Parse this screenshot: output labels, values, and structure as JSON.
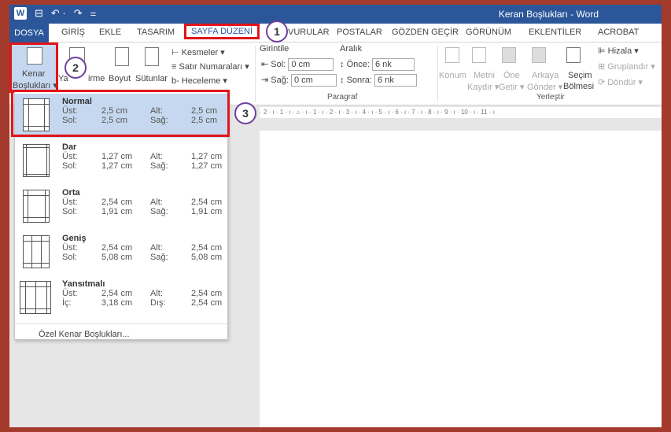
{
  "titlebar": {
    "app_title": "Keran Boşlukları - Word",
    "qa_save": "⊟",
    "qa_undo": "↶ ·",
    "qa_redo": "↷",
    "qa_more": "="
  },
  "tabs": {
    "file": "DOSYA",
    "home": "GİRİŞ",
    "insert": "EKLE",
    "design": "TASARIM",
    "layout": "SAYFA DÜZENİ",
    "references": "BAŞVURULAR",
    "mailings": "POSTALAR",
    "review": "GÖZDEN GEÇİR",
    "view": "GÖRÜNÜM",
    "addins": "EKLENTİLER",
    "acrobat": "ACROBAT"
  },
  "ribbon": {
    "margins_line1": "Kenar",
    "margins_line2": "Boşlukları ▾",
    "orientation_part": "Ya",
    "orientation_rest": "irme",
    "size": "Boyut",
    "columns": "Sütunlar",
    "breaks": "Kesmeler ▾",
    "line_numbers": "Satır Numaraları ▾",
    "hyphenation": "Heceleme ▾",
    "indent_label": "Girintile",
    "spacing_label": "Aralık",
    "indent_left_label": "Sol:",
    "indent_left_value": "0 cm",
    "indent_right_label": "Sağ:",
    "indent_right_value": "0 cm",
    "spacing_before_label": "Önce:",
    "spacing_before_value": "6 nk",
    "spacing_after_label": "Sonra:",
    "spacing_after_value": "6 nk",
    "paragraph_group": "Paragraf",
    "position": "Konum",
    "wrap_line1": "Metni",
    "wrap_line2": "Kaydır ▾",
    "forward_line1": "Öne",
    "forward_line2": "Getir ▾",
    "backward_line1": "Arkaya",
    "backward_line2": "Gönder ▾",
    "selection_line1": "Seçim",
    "selection_line2": "Bölmesi",
    "align": "Hizala ▾",
    "group": "Gruplandır ▾",
    "rotate": "Döndür ▾",
    "arrange_group": "Yerleştir"
  },
  "ruler_text": "· 2 · ı · 1 · ı · ⌂ · ı · 1 · ı · 2 · ı · 3 · ı · 4 · ı · 5 · ı · 6 · ı · 7 · ı · 8 · ı · 9 · ı · 10 · ı · 11 · ı",
  "margin_options": [
    {
      "name": "Normal",
      "l1a": "Üst:",
      "v1a": "2,5 cm",
      "l1b": "Alt:",
      "v1b": "2,5 cm",
      "l2a": "Sol:",
      "v2a": "2,5 cm",
      "l2b": "Sağ:",
      "v2b": "2,5 cm"
    },
    {
      "name": "Dar",
      "l1a": "Üst:",
      "v1a": "1,27 cm",
      "l1b": "Alt:",
      "v1b": "1,27 cm",
      "l2a": "Sol:",
      "v2a": "1,27 cm",
      "l2b": "Sağ:",
      "v2b": "1,27 cm"
    },
    {
      "name": "Orta",
      "l1a": "Üst:",
      "v1a": "2,54 cm",
      "l1b": "Alt:",
      "v1b": "2,54 cm",
      "l2a": "Sol:",
      "v2a": "1,91 cm",
      "l2b": "Sağ:",
      "v2b": "1,91 cm"
    },
    {
      "name": "Geniş",
      "l1a": "Üst:",
      "v1a": "2,54 cm",
      "l1b": "Alt:",
      "v1b": "2,54 cm",
      "l2a": "Sol:",
      "v2a": "5,08 cm",
      "l2b": "Sağ:",
      "v2b": "5,08 cm"
    },
    {
      "name": "Yansıtmalı",
      "l1a": "Üst:",
      "v1a": "2,54 cm",
      "l1b": "Alt:",
      "v1b": "2,54 cm",
      "l2a": "İç:",
      "v2a": "3,18 cm",
      "l2b": "Dış:",
      "v2b": "2,54 cm"
    }
  ],
  "custom_margins": "Özel Kenar Boşlukları...",
  "badges": {
    "one": "1",
    "two": "2",
    "three": "3"
  },
  "colors": {
    "accent": "#2b579a",
    "highlight": "#e2141a",
    "badge_ring": "#6f3f9c",
    "selected": "#c5d8ef"
  }
}
